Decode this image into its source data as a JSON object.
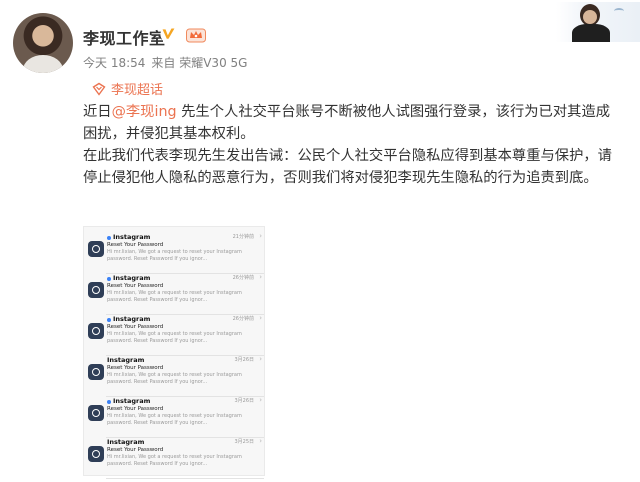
{
  "post": {
    "author": "李现工作室",
    "time": "今天 18:54",
    "source": "来自 荣耀V30 5G",
    "topic": "李现超话",
    "paragraph1_prefix": "近日",
    "mention": "@李现ing",
    "paragraph1_rest": " 先生个人社交平台账号不断被他人试图强行登录，该行为已对其造成困扰，并侵犯其基本权利。",
    "paragraph2": "在此我们代表李现先生发出告诫：公民个人社交平台隐私应得到基本尊重与保护，请停止侵犯他人隐私的恶意行为，否则我们将对侵犯李现先生隐私的行为追责到底。"
  },
  "icons": {
    "verified": "verified-v-icon",
    "member": "member-crown-icon",
    "topic": "super-topic-icon",
    "app": "instagram-icon"
  },
  "colors": {
    "accent": "#eb7350",
    "verified": "#f5a623",
    "unread_dot": "#3b82f6"
  },
  "emails": [
    {
      "sender": "Instagram",
      "subject": "Reset Your Password",
      "preview": "Hi mr.lixian, We got a request to reset your Instagram password. Reset Password If you ignor...",
      "time": "21分钟前",
      "unread": true
    },
    {
      "sender": "Instagram",
      "subject": "Reset Your Password",
      "preview": "Hi mr.lixian, We got a request to reset your Instagram password. Reset Password If you ignor...",
      "time": "26分钟前",
      "unread": true
    },
    {
      "sender": "Instagram",
      "subject": "Reset Your Password",
      "preview": "Hi mr.lixian, We got a request to reset your Instagram password. Reset Password If you ignor...",
      "time": "26分钟前",
      "unread": true
    },
    {
      "sender": "Instagram",
      "subject": "Reset Your Password",
      "preview": "Hi mr.lixian, We got a request to reset your Instagram password. Reset Password If you ignor...",
      "time": "3月26日",
      "unread": false
    },
    {
      "sender": "Instagram",
      "subject": "Reset Your Password",
      "preview": "Hi mr.lixian, We got a request to reset your Instagram password. Reset Password If you ignor...",
      "time": "3月26日",
      "unread": true
    },
    {
      "sender": "Instagram",
      "subject": "Reset Your Password",
      "preview": "Hi mr.lixian, We got a request to reset your Instagram password. Reset Password If you ignor...",
      "time": "3月25日",
      "unread": false
    }
  ]
}
